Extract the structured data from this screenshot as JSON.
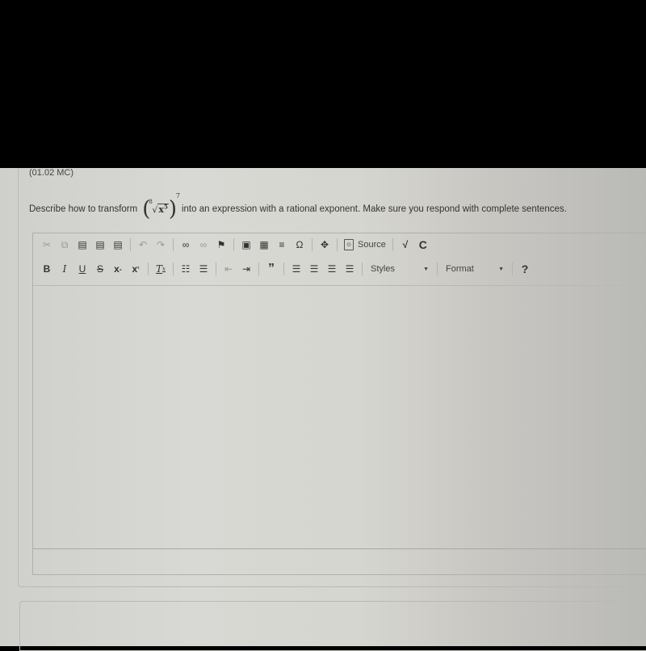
{
  "question": {
    "id_label": "(01.02 MC)",
    "prompt_before": "Describe how to transform",
    "expression": {
      "root_index": "8",
      "base": "x",
      "base_exponent": "5",
      "outer_exponent": "7"
    },
    "prompt_after": "into an expression with a rational exponent. Make sure you respond with complete sentences."
  },
  "toolbar": {
    "row1": [
      {
        "name": "cut-icon",
        "glyph": "✂",
        "disabled": true
      },
      {
        "name": "copy-icon",
        "glyph": "⧉",
        "disabled": true
      },
      {
        "name": "paste-icon",
        "glyph": "📋",
        "disabled": false
      },
      {
        "name": "paste-text-icon",
        "glyph": "📋",
        "disabled": false
      },
      {
        "name": "paste-word-icon",
        "glyph": "📋",
        "disabled": false
      },
      {
        "name": "undo-icon",
        "glyph": "↶",
        "disabled": true
      },
      {
        "name": "redo-icon",
        "glyph": "↷",
        "disabled": true
      },
      {
        "name": "link-icon",
        "glyph": "⛓",
        "disabled": false
      },
      {
        "name": "unlink-icon",
        "glyph": "⛓",
        "disabled": true
      },
      {
        "name": "anchor-flag-icon",
        "glyph": "⚑",
        "disabled": false
      },
      {
        "name": "image-icon",
        "glyph": "🖼",
        "disabled": false
      },
      {
        "name": "table-icon",
        "glyph": "▦",
        "disabled": false
      },
      {
        "name": "horizontal-line-icon",
        "glyph": "☰",
        "disabled": false
      },
      {
        "name": "special-char-icon",
        "glyph": "Ω",
        "disabled": false
      },
      {
        "name": "maximize-icon",
        "glyph": "⤧",
        "disabled": false
      }
    ],
    "source_label": "Source",
    "sqrt_label": "√",
    "c_label": "C",
    "row2": [
      {
        "name": "bold-button",
        "glyph": "B"
      },
      {
        "name": "italic-button",
        "glyph": "I"
      },
      {
        "name": "underline-button",
        "glyph": "U"
      },
      {
        "name": "strikethrough-button",
        "glyph": "S"
      },
      {
        "name": "subscript-button",
        "glyph": "x₂"
      },
      {
        "name": "superscript-button",
        "glyph": "x²"
      },
      {
        "name": "remove-format-button",
        "glyph": "Tx"
      },
      {
        "name": "numbered-list-button",
        "glyph": "≔"
      },
      {
        "name": "bulleted-list-button",
        "glyph": "⁝≡"
      },
      {
        "name": "outdent-button",
        "glyph": "⇤"
      },
      {
        "name": "indent-button",
        "glyph": "⇥"
      },
      {
        "name": "blockquote-button",
        "glyph": "❞"
      },
      {
        "name": "align-left-button",
        "glyph": "☰"
      },
      {
        "name": "align-center-button",
        "glyph": "☰"
      },
      {
        "name": "align-right-button",
        "glyph": "☰"
      },
      {
        "name": "justify-button",
        "glyph": "☰"
      }
    ],
    "styles_label": "Styles",
    "format_label": "Format",
    "help_label": "?"
  }
}
